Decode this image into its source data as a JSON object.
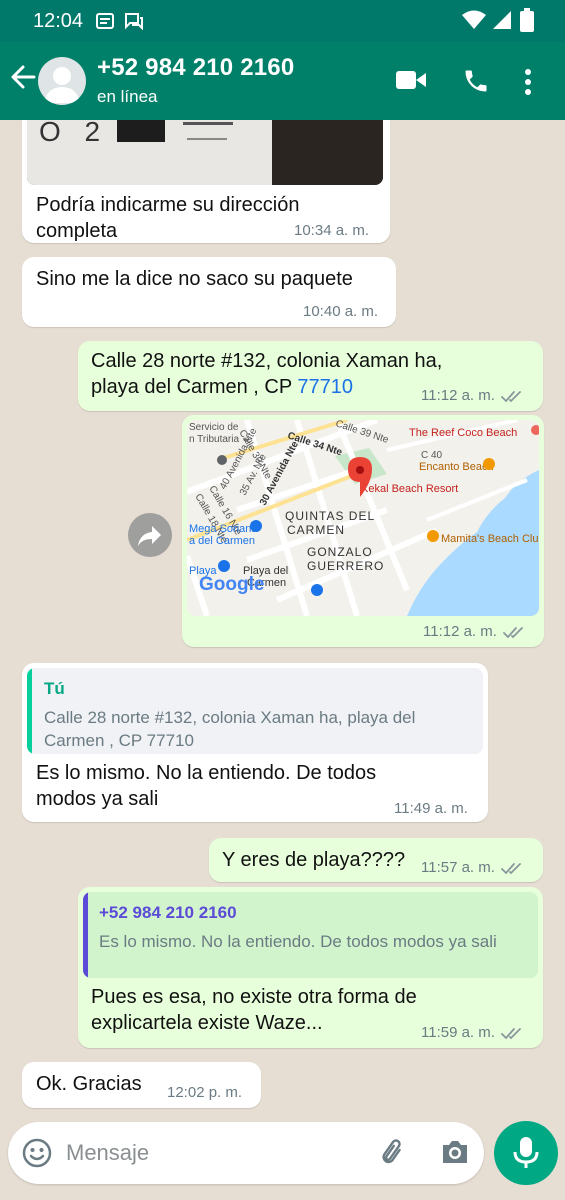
{
  "status_bar": {
    "time": "12:04"
  },
  "header": {
    "contact_name": "+52 984 210 2160",
    "contact_status": "en línea"
  },
  "messages": [
    {
      "direction": "in",
      "type": "image_caption",
      "image_text": "O 2",
      "text": "Podría indicarme su dirección completa",
      "time": "10:34 a. m."
    },
    {
      "direction": "in",
      "type": "text",
      "text": "Sino me la dice no saco su paquete",
      "time": "10:40 a. m."
    },
    {
      "direction": "out",
      "type": "text",
      "text_main": "Calle 28 norte #132, colonia Xaman ha, playa del Carmen , CP ",
      "text_link": "77710",
      "time": "11:12 a. m.",
      "status": "read"
    },
    {
      "direction": "out",
      "type": "location",
      "time": "11:12 a. m.",
      "status": "read",
      "map_labels": [
        "Servicio de",
        "n Tributaria",
        "Calle 30 Nte",
        "Calle 34 Nte",
        "Calle 39 Nte",
        "40 Avenida Nte",
        "35 Av. Nte",
        "30 Avenida Nte",
        "Calle 18 Nte",
        "Calle 16 Nte",
        "QUINTAS DEL",
        "CARMEN",
        "GONZALO",
        "GUERRERO",
        "Mega Soriana",
        "a del Carmen",
        "Playa",
        "Playa del",
        "Carmen",
        "C 40",
        "The Reef Coco Beach",
        "Encanto Beach",
        "Kekal Beach Resort",
        "Mamita's Beach Club",
        "Google"
      ]
    },
    {
      "direction": "in",
      "type": "reply",
      "quote_author": "Tú",
      "quote_text": "Calle 28 norte #132, colonia Xaman ha, playa del Carmen , CP 77710",
      "text": "Es lo mismo. No la entiendo. De todos modos ya sali",
      "time": "11:49 a. m."
    },
    {
      "direction": "out",
      "type": "text",
      "text": "Y eres de playa????",
      "time": "11:57 a. m.",
      "status": "read"
    },
    {
      "direction": "out",
      "type": "reply",
      "quote_author": "+52 984 210 2160",
      "quote_text": "Es lo mismo. No la entiendo. De todos modos ya sali",
      "text": "Pues es esa, no existe otra forma de explicartela existe Waze...",
      "time": "11:59 a. m.",
      "status": "read"
    },
    {
      "direction": "in",
      "type": "text",
      "text": "Ok. Gracias",
      "time": "12:02 p. m."
    }
  ],
  "composer": {
    "placeholder": "Mensaje"
  },
  "colors": {
    "header": "#008069",
    "status_bar": "#00796b",
    "outgoing": "#e7ffdb",
    "incoming": "#ffffff",
    "accent": "#00a884",
    "link": "#1b72e8",
    "quote_self": "#06cf9c",
    "quote_other": "#5b4bd6"
  },
  "icons": [
    "back-arrow-icon",
    "avatar-placeholder-icon",
    "video-call-icon",
    "phone-call-icon",
    "more-vert-icon",
    "forward-icon",
    "map-pin-icon",
    "double-check-icon",
    "emoji-icon",
    "attach-icon",
    "camera-icon",
    "mic-icon"
  ]
}
